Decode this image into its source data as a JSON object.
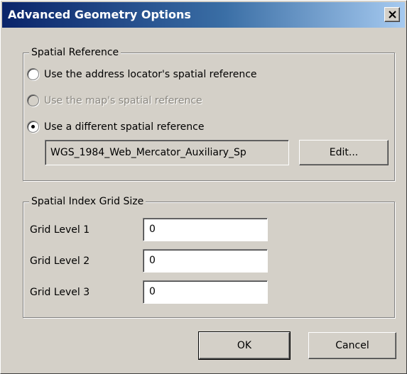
{
  "window": {
    "title": "Advanced Geometry Options",
    "close_icon": "close-icon"
  },
  "spatial_reference": {
    "legend": "Spatial Reference",
    "options": [
      {
        "label": "Use the address locator's spatial reference",
        "selected": false,
        "enabled": true
      },
      {
        "label": "Use the map's spatial reference",
        "selected": false,
        "enabled": false
      },
      {
        "label": "Use a different spatial reference",
        "selected": true,
        "enabled": true
      }
    ],
    "value": "WGS_1984_Web_Mercator_Auxiliary_Sp",
    "edit_label": "Edit..."
  },
  "grid_size": {
    "legend": "Spatial Index Grid Size",
    "levels": [
      {
        "label": "Grid Level 1",
        "value": "0"
      },
      {
        "label": "Grid Level 2",
        "value": "0"
      },
      {
        "label": "Grid Level 3",
        "value": "0"
      }
    ]
  },
  "buttons": {
    "ok_label": "OK",
    "cancel_label": "Cancel"
  },
  "colors": {
    "face": "#d4d0c8",
    "title_start": "#0a246a",
    "title_end": "#a6caf0",
    "disabled_text": "#8a8780"
  }
}
